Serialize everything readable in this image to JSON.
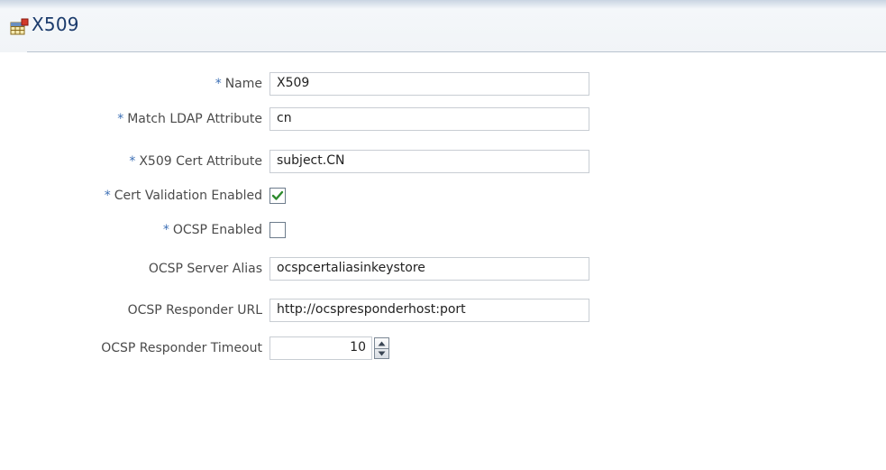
{
  "page": {
    "title": "X509"
  },
  "form": {
    "fields": [
      {
        "label": "Name",
        "required": true,
        "value": "X509"
      },
      {
        "label": "Match LDAP Attribute",
        "required": true,
        "value": "cn"
      },
      {
        "label": "X509 Cert Attribute",
        "required": true,
        "value": "subject.CN"
      },
      {
        "label": "Cert Validation Enabled",
        "required": true,
        "checked": true
      },
      {
        "label": "OCSP Enabled",
        "required": true,
        "checked": false
      },
      {
        "label": "OCSP Server Alias",
        "required": false,
        "value": "ocspcertaliasinkeystore"
      },
      {
        "label": "OCSP Responder URL",
        "required": false,
        "value": "http://ocspresponderhost:port"
      },
      {
        "label": "OCSP Responder Timeout",
        "required": false,
        "value": "10"
      }
    ],
    "required_marker": "*"
  },
  "icons": {
    "title_icon": "table-icon",
    "checkbox_check": "check-icon",
    "spinner_up": "arrow-up-icon",
    "spinner_down": "arrow-down-icon"
  },
  "colors": {
    "title": "#1b3b6c",
    "required_marker": "#3c6fb5",
    "check": "#2e8b2e"
  }
}
